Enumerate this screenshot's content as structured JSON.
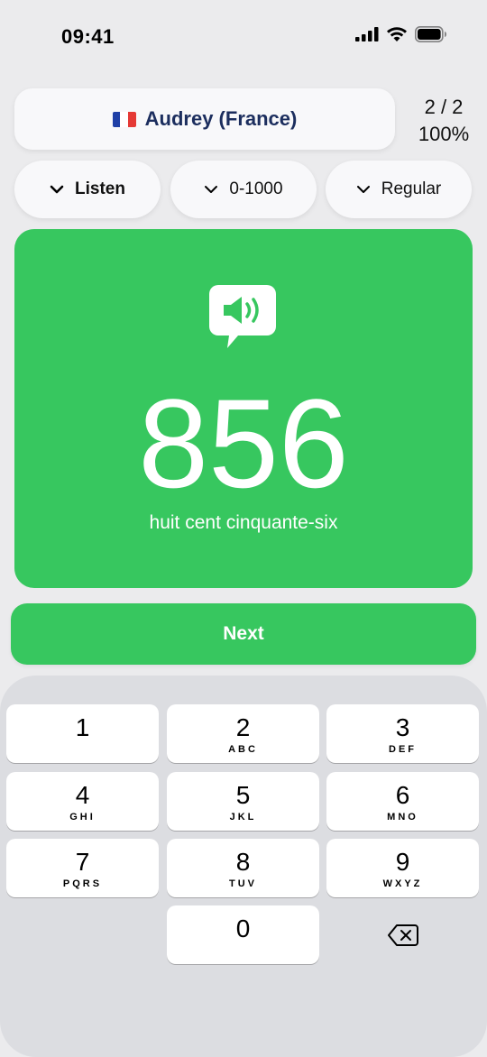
{
  "status_bar": {
    "time": "09:41",
    "icons": [
      "signal-icon",
      "wifi-icon",
      "battery-icon"
    ]
  },
  "header": {
    "voice_label": "Audrey (France)",
    "flag_colors": [
      "#1f3fa6",
      "#ffffff",
      "#e53935"
    ],
    "progress_count": "2 / 2",
    "progress_percent": "100%"
  },
  "dropdowns": [
    {
      "label": "Listen",
      "icon": "chevron-down-icon"
    },
    {
      "label": "0-1000",
      "icon": "chevron-down-icon"
    },
    {
      "label": "Regular",
      "icon": "chevron-down-icon"
    }
  ],
  "card": {
    "icon": "speaker-bubble-icon",
    "number": "856",
    "words": "huit cent cinquante-six",
    "color": "#37c75f"
  },
  "next_button": {
    "label": "Next"
  },
  "keypad": {
    "keys": [
      {
        "digit": "1",
        "letters": ""
      },
      {
        "digit": "2",
        "letters": "ABC"
      },
      {
        "digit": "3",
        "letters": "DEF"
      },
      {
        "digit": "4",
        "letters": "GHI"
      },
      {
        "digit": "5",
        "letters": "JKL"
      },
      {
        "digit": "6",
        "letters": "MNO"
      },
      {
        "digit": "7",
        "letters": "PQRS"
      },
      {
        "digit": "8",
        "letters": "TUV"
      },
      {
        "digit": "9",
        "letters": "WXYZ"
      },
      {
        "digit": "0",
        "letters": ""
      }
    ],
    "delete_icon": "backspace-icon"
  }
}
